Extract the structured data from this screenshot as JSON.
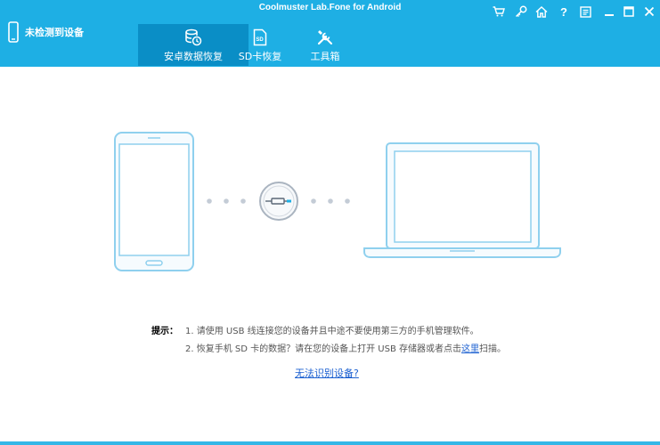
{
  "window": {
    "title": "Coolmuster Lab.Fone for Android",
    "controls": [
      "cart-icon",
      "key-icon",
      "home-icon",
      "help-icon",
      "feedback-icon",
      "minimize-icon",
      "maximize-icon",
      "close-icon"
    ]
  },
  "device": {
    "status": "未检测到设备"
  },
  "tabs": [
    {
      "label": "安卓数据恢复",
      "icon": "database-restore-icon",
      "active": true
    },
    {
      "label": "SD卡恢复",
      "icon": "sd-card-icon",
      "active": false
    },
    {
      "label": "工具箱",
      "icon": "tools-icon",
      "active": false
    }
  ],
  "tips": {
    "label": "提示：",
    "line1": "1. 请使用 USB 线连接您的设备并且中途不要使用第三方的手机管理软件。",
    "line2_prefix": "2. 恢复手机 SD 卡的数据？请在您的设备上打开 USB 存储器或者点击",
    "line2_link": "这里",
    "line2_suffix": "扫描。"
  },
  "help_link": "无法识别设备?",
  "colors": {
    "header": "#1eafe4",
    "active_tab": "#0a8ec6",
    "illustration": "#8fd0ee",
    "link": "#1a5fd0"
  }
}
